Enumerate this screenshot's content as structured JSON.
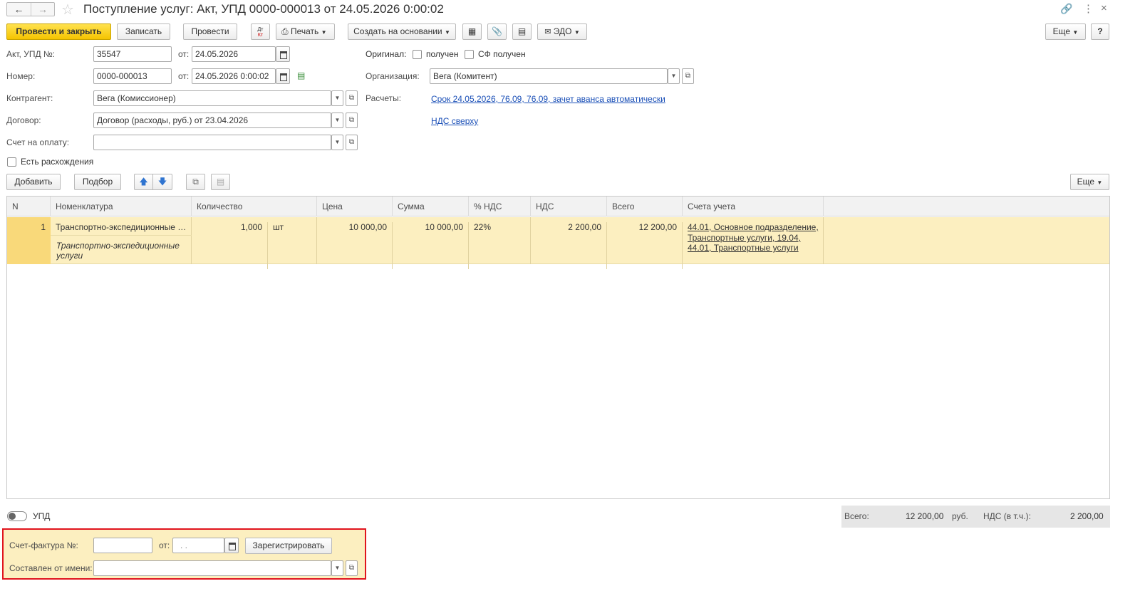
{
  "window": {
    "title": "Поступление услуг: Акт, УПД 0000-000013 от 24.05.2026 0:00:02"
  },
  "toolbar": {
    "post_close": "Провести и закрыть",
    "save": "Записать",
    "post": "Провести",
    "print": "Печать",
    "create_based": "Создать на основании",
    "edo": "ЭДО",
    "more": "Еще",
    "help": "?"
  },
  "form": {
    "act_label": "Акт, УПД №:",
    "act_value": "35547",
    "from_label": "от:",
    "act_date": "24.05.2026",
    "number_label": "Номер:",
    "number_value": "0000-000013",
    "number_date": "24.05.2026  0:00:02",
    "contractor_label": "Контрагент:",
    "contractor_value": "Вега (Комиссионер)",
    "contract_label": "Договор:",
    "contract_value": "Договор (расходы, руб.) от 23.04.2026",
    "invoice_label": "Счет на оплату:",
    "invoice_value": "",
    "discrepancy_label": "Есть расхождения",
    "original_label": "Оригинал:",
    "received_label": "получен",
    "sf_received_label": "СФ получен",
    "org_label": "Организация:",
    "org_value": "Вега (Комитент)",
    "settlements_label": "Расчеты:",
    "settlements_link": "Срок 24.05.2026, 76.09, 76.09, зачет аванса автоматически",
    "vat_link": "НДС сверху"
  },
  "table_toolbar": {
    "add": "Добавить",
    "select": "Подбор",
    "more": "Еще"
  },
  "table": {
    "headers": [
      "N",
      "Номенклатура",
      "Количество",
      "Цена",
      "Сумма",
      "% НДС",
      "НДС",
      "Всего",
      "Счета учета"
    ],
    "rows": [
      {
        "n": "1",
        "nomenclature": "Транспортно-экспедиционные …",
        "content_line1": "Транспортно-экспедиционные",
        "content_line2": "услуги",
        "qty": "1,000",
        "unit": "шт",
        "price": "10 000,00",
        "sum": "10 000,00",
        "vat_rate": "22%",
        "vat": "2 200,00",
        "total": "12 200,00",
        "accounts_line1": "44.01, Основное подразделение,",
        "accounts_line2": "Транспортные услуги, 19.04,",
        "accounts_line3": "44.01, Транспортные услуги"
      }
    ]
  },
  "footer": {
    "upd_label": "УПД",
    "total_label": "Всего:",
    "total_value": "12 200,00",
    "currency": "руб.",
    "vat_label": "НДС (в т.ч.):",
    "vat_value": "2 200,00"
  },
  "invoice_section": {
    "invoice_label": "Счет-фактура №:",
    "invoice_value": "",
    "from_label": "от:",
    "date_placeholder": " .  .",
    "register_button": "Зарегистрировать",
    "issued_by_label": "Составлен от имени:",
    "issued_by_value": ""
  },
  "colors": {
    "accent_yellow": "#f5c400",
    "row_highlight": "#fcefc0",
    "link": "#1a4fb7",
    "highlight_border": "#e0141e"
  }
}
